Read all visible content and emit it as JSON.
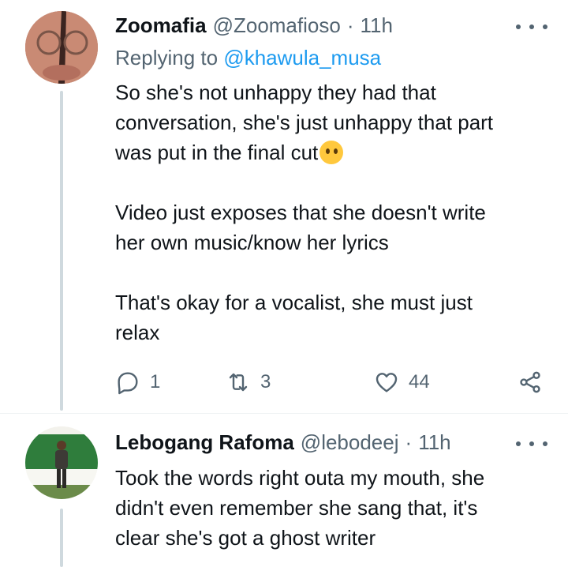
{
  "tweets": [
    {
      "author": {
        "name": "Zoomafia",
        "handle": "@Zoomafioso",
        "time": "11h",
        "avatar_icon": "profile-photo"
      },
      "reply_to": {
        "prefix": "Replying to",
        "mention": "@khawula_musa"
      },
      "paragraphs": [
        {
          "lines": [
            "So she's not unhappy they had that",
            "conversation, she's just unhappy that part",
            "was put in the final cut"
          ],
          "emoji": "thinking-face"
        },
        {
          "lines": [
            "Video just exposes that she doesn't write",
            "her own music/know her lyrics"
          ]
        },
        {
          "lines": [
            "That's okay for a vocalist, she must just",
            "relax"
          ]
        }
      ],
      "actions": {
        "reply_count": "1",
        "retweet_count": "3",
        "like_count": "44"
      }
    },
    {
      "author": {
        "name": "Lebogang Rafoma",
        "handle": "@lebodeej",
        "time": "11h",
        "avatar_icon": "profile-photo"
      },
      "paragraphs": [
        {
          "lines": [
            "Took the words right outa my mouth, she",
            "didn't even remember she sang that, it's",
            "clear she's got a ghost writer"
          ]
        }
      ]
    }
  ],
  "separator_dot": "·",
  "colors": {
    "text_primary": "#0f1419",
    "text_secondary": "#536471",
    "link": "#1d9bf0",
    "thread_line": "#cfd9de"
  }
}
